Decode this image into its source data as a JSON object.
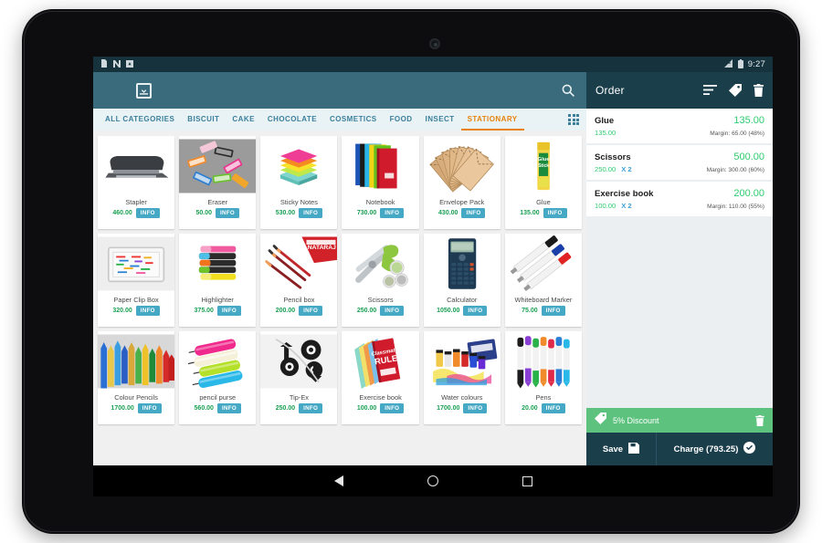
{
  "status_bar": {
    "left_icons": [
      "sdcard-icon",
      "nfc-icon",
      "app-icon"
    ],
    "signal_icon": "signal-bars-icon",
    "battery_icon": "battery-icon",
    "time": "9:27"
  },
  "app_bar": {
    "menu_icon": "hamburger-menu-icon",
    "save_icon": "download-box-icon",
    "search_icon": "search-icon"
  },
  "categories": {
    "items": [
      {
        "label": "ALL CATEGORIES",
        "active": false
      },
      {
        "label": "BISCUIT",
        "active": false
      },
      {
        "label": "CAKE",
        "active": false
      },
      {
        "label": "CHOCOLATE",
        "active": false
      },
      {
        "label": "COSMETICS",
        "active": false
      },
      {
        "label": "FOOD",
        "active": false
      },
      {
        "label": "INSECT",
        "active": false
      },
      {
        "label": "STATIONARY",
        "active": true
      }
    ],
    "grid_toggle_icon": "grid-view-icon"
  },
  "products": [
    {
      "name": "Stapler",
      "price": "460.00",
      "info": "INFO",
      "art": "stapler"
    },
    {
      "name": "Eraser",
      "price": "50.00",
      "info": "INFO",
      "art": "eraser"
    },
    {
      "name": "Sticky Notes",
      "price": "530.00",
      "info": "INFO",
      "art": "sticky"
    },
    {
      "name": "Notebook",
      "price": "730.00",
      "info": "INFO",
      "art": "notebook"
    },
    {
      "name": "Envelope Pack",
      "price": "430.00",
      "info": "INFO",
      "art": "envelope"
    },
    {
      "name": "Glue",
      "price": "135.00",
      "info": "INFO",
      "art": "glue"
    },
    {
      "name": "Paper Clip Box",
      "price": "320.00",
      "info": "INFO",
      "art": "clips"
    },
    {
      "name": "Highlighter",
      "price": "375.00",
      "info": "INFO",
      "art": "highlighter"
    },
    {
      "name": "Pencil box",
      "price": "200.00",
      "info": "INFO",
      "art": "pencilbox"
    },
    {
      "name": "Scissors",
      "price": "250.00",
      "info": "INFO",
      "art": "scissors"
    },
    {
      "name": "Calculator",
      "price": "1050.00",
      "info": "INFO",
      "art": "calculator"
    },
    {
      "name": "Whiteboard Marker",
      "price": "75.00",
      "info": "INFO",
      "art": "marker"
    },
    {
      "name": "Colour Pencils",
      "price": "1700.00",
      "info": "INFO",
      "art": "colourpencils"
    },
    {
      "name": "pencil purse",
      "price": "560.00",
      "info": "INFO",
      "art": "purse"
    },
    {
      "name": "Tip-Ex",
      "price": "250.00",
      "info": "INFO",
      "art": "tipex"
    },
    {
      "name": "Exercise book",
      "price": "100.00",
      "info": "INFO",
      "art": "exercisebook"
    },
    {
      "name": "Water colours",
      "price": "1700.00",
      "info": "INFO",
      "art": "watercolours"
    },
    {
      "name": "Pens",
      "price": "20.00",
      "info": "INFO",
      "art": "pens"
    }
  ],
  "order": {
    "title": "Order",
    "sort_icon": "sort-lines-icon",
    "tag_icon": "tag-icon",
    "trash_icon": "trash-icon",
    "items": [
      {
        "name": "Glue",
        "total": "135.00",
        "unit": "135.00",
        "qty": "",
        "margin": "Margin: 65.00 (48%)"
      },
      {
        "name": "Scissors",
        "total": "500.00",
        "unit": "250.00",
        "qty": "X 2",
        "margin": "Margin: 300.00 (60%)"
      },
      {
        "name": "Exercise book",
        "total": "200.00",
        "unit": "100.00",
        "qty": "X 2",
        "margin": "Margin: 110.00 (55%)"
      }
    ],
    "discount": {
      "tag_icon": "tag-icon",
      "label": "5% Discount",
      "delete_icon": "trash-icon"
    },
    "save_label": "Save",
    "save_icon": "floppy-save-icon",
    "charge_label": "Charge (793.25)",
    "charge_icon": "check-circle-icon"
  },
  "nav_bar": {
    "back_icon": "back-triangle-icon",
    "home_icon": "home-circle-icon",
    "recents_icon": "recents-square-icon"
  },
  "colors": {
    "appbar": "#3a6b7c",
    "order_header": "#1b3e4b",
    "accent_orange": "#e8820c",
    "category_blue": "#3b7f9b",
    "price_green": "#1aa053",
    "total_green": "#2ecb6e",
    "info_button": "#45a8c4",
    "discount_green": "#5dc27e"
  }
}
